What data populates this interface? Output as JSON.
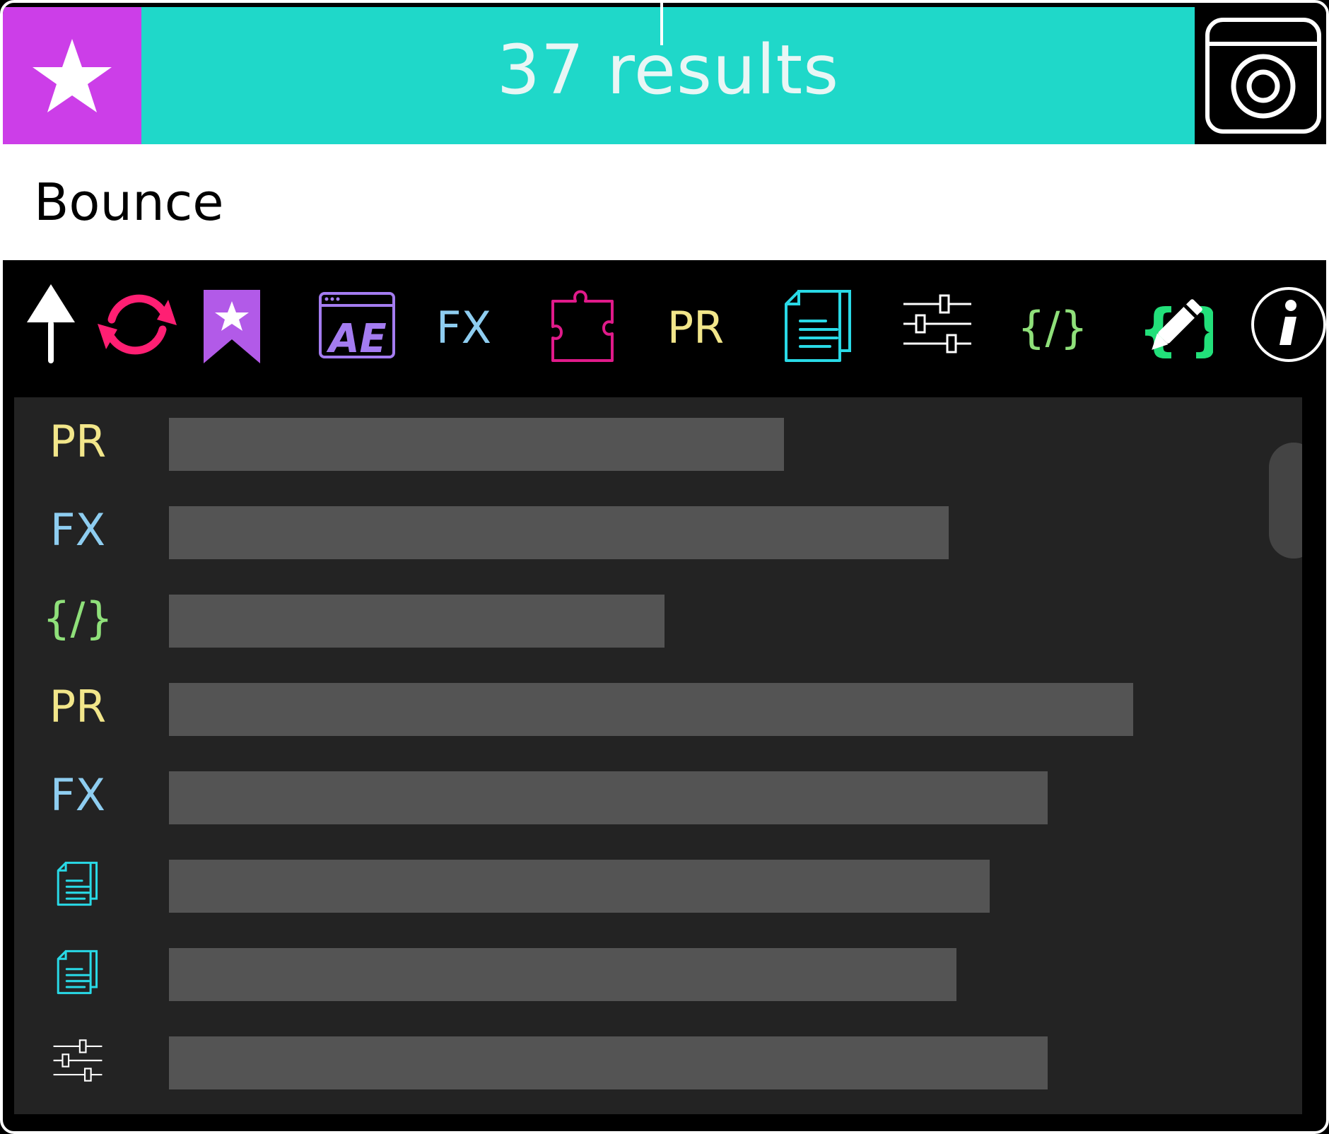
{
  "header": {
    "title": "37 results",
    "favorites_icon": "star-icon",
    "screenshot_icon": "screenshot-window-icon"
  },
  "search": {
    "value": "Bounce",
    "placeholder": ""
  },
  "toolbar": {
    "items": [
      {
        "name": "up-arrow-icon",
        "color": "#ffffff"
      },
      {
        "name": "refresh-icon",
        "color": "#ff1f73"
      },
      {
        "name": "bookmark-star-icon",
        "color": "#b25ae8"
      },
      {
        "name": "ae-icon",
        "label": "AE",
        "color": "#a47cf0"
      },
      {
        "name": "fx-filter",
        "label": "FX",
        "color": "#8ecdf0"
      },
      {
        "name": "puzzle-icon",
        "color": "#e01a8a"
      },
      {
        "name": "pr-filter",
        "label": "PR",
        "color": "#f2e68a"
      },
      {
        "name": "document-icon",
        "color": "#29d9e6"
      },
      {
        "name": "sliders-icon",
        "color": "#ffffff"
      },
      {
        "name": "code-filter",
        "label": "{/}",
        "color": "#8fe07a"
      },
      {
        "name": "edit-code-icon",
        "color": "#22e07a"
      },
      {
        "name": "info-icon",
        "color": "#ffffff"
      }
    ]
  },
  "results": [
    {
      "type": "PR",
      "color": "#f2e68a",
      "level": 0.638
    },
    {
      "type": "FX",
      "color": "#8ecdf0",
      "level": 0.809
    },
    {
      "type": "{/}",
      "color": "#8fe07a",
      "level": 0.514
    },
    {
      "type": "PR",
      "color": "#f2e68a",
      "level": 1.0
    },
    {
      "type": "FX",
      "color": "#8ecdf0",
      "level": 0.911
    },
    {
      "type": "document",
      "color": "#29d9e6",
      "level": 0.851
    },
    {
      "type": "document",
      "color": "#29d9e6",
      "level": 0.817
    },
    {
      "type": "sliders",
      "color": "#ffffff",
      "level": 0.911
    }
  ]
}
